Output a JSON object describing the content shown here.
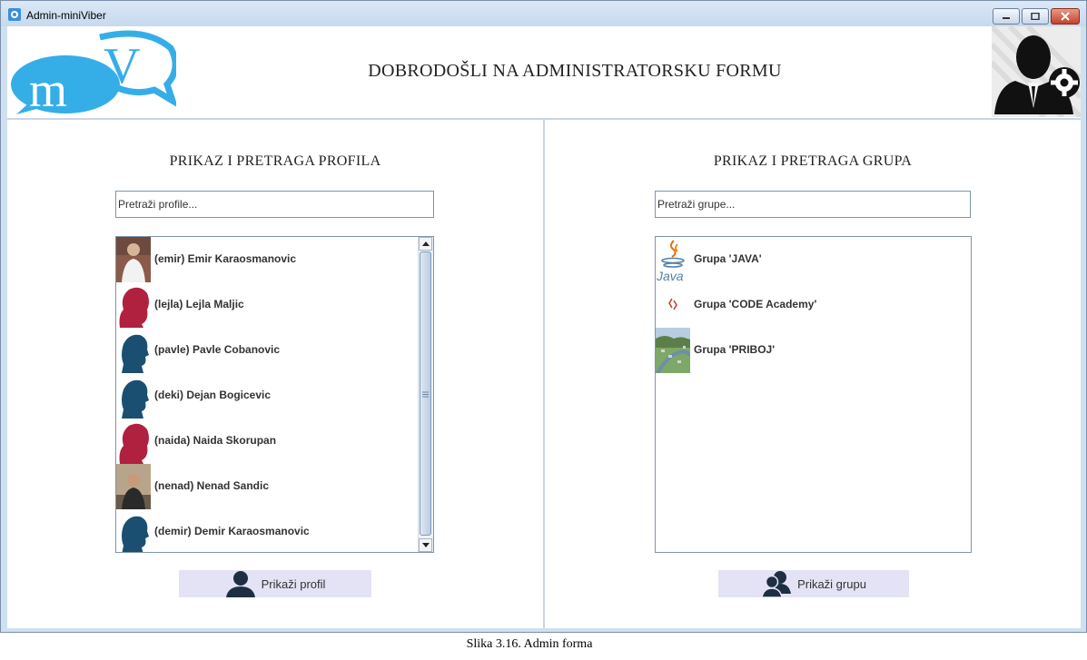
{
  "window": {
    "title": "Admin-miniViber",
    "controls": [
      "minimize-icon",
      "maximize-icon",
      "close-icon"
    ]
  },
  "header": {
    "logo_text": "mV",
    "title": "DOBRODOŠLI NA ADMINISTRATORSKU FORMU"
  },
  "profiles": {
    "title": "PRIKAZ I PRETRAGA PROFILA",
    "search": {
      "value": "",
      "placeholder": "Pretraži profile..."
    },
    "items": [
      {
        "label": "(emir) Emir Karaosmanovic",
        "avatar": "photo"
      },
      {
        "label": "(lejla) Lejla Maljic",
        "avatar": "female-silhouette"
      },
      {
        "label": "(pavle) Pavle Cobanovic",
        "avatar": "male-silhouette"
      },
      {
        "label": "(deki) Dejan Bogicevic",
        "avatar": "male-silhouette"
      },
      {
        "label": "(naida) Naida Skorupan",
        "avatar": "female-silhouette"
      },
      {
        "label": "(nenad) Nenad Sandic",
        "avatar": "photo"
      },
      {
        "label": "(demir) Demir Karaosmanovic",
        "avatar": "male-silhouette"
      }
    ],
    "button_label": "Prikaži profil"
  },
  "groups": {
    "title": "PRIKAZ I PRETRAGA GRUPA",
    "search": {
      "value": "",
      "placeholder": "Pretraži grupe..."
    },
    "items": [
      {
        "label": "Grupa 'JAVA'",
        "icon": "java-logo",
        "icon_text": "Java"
      },
      {
        "label": "Grupa 'CODE Academy'",
        "icon": "code-academy-logo"
      },
      {
        "label": "Grupa 'PRIBOJ'",
        "icon": "town-photo"
      }
    ],
    "button_label": "Prikaži grupu"
  },
  "caption": "Slika 3.16. Admin forma",
  "colors": {
    "female_silhouette": "#b0213f",
    "male_silhouette": "#1b4f72",
    "button_bg": "#e3e3f5",
    "logo_blue": "#35aee8"
  }
}
